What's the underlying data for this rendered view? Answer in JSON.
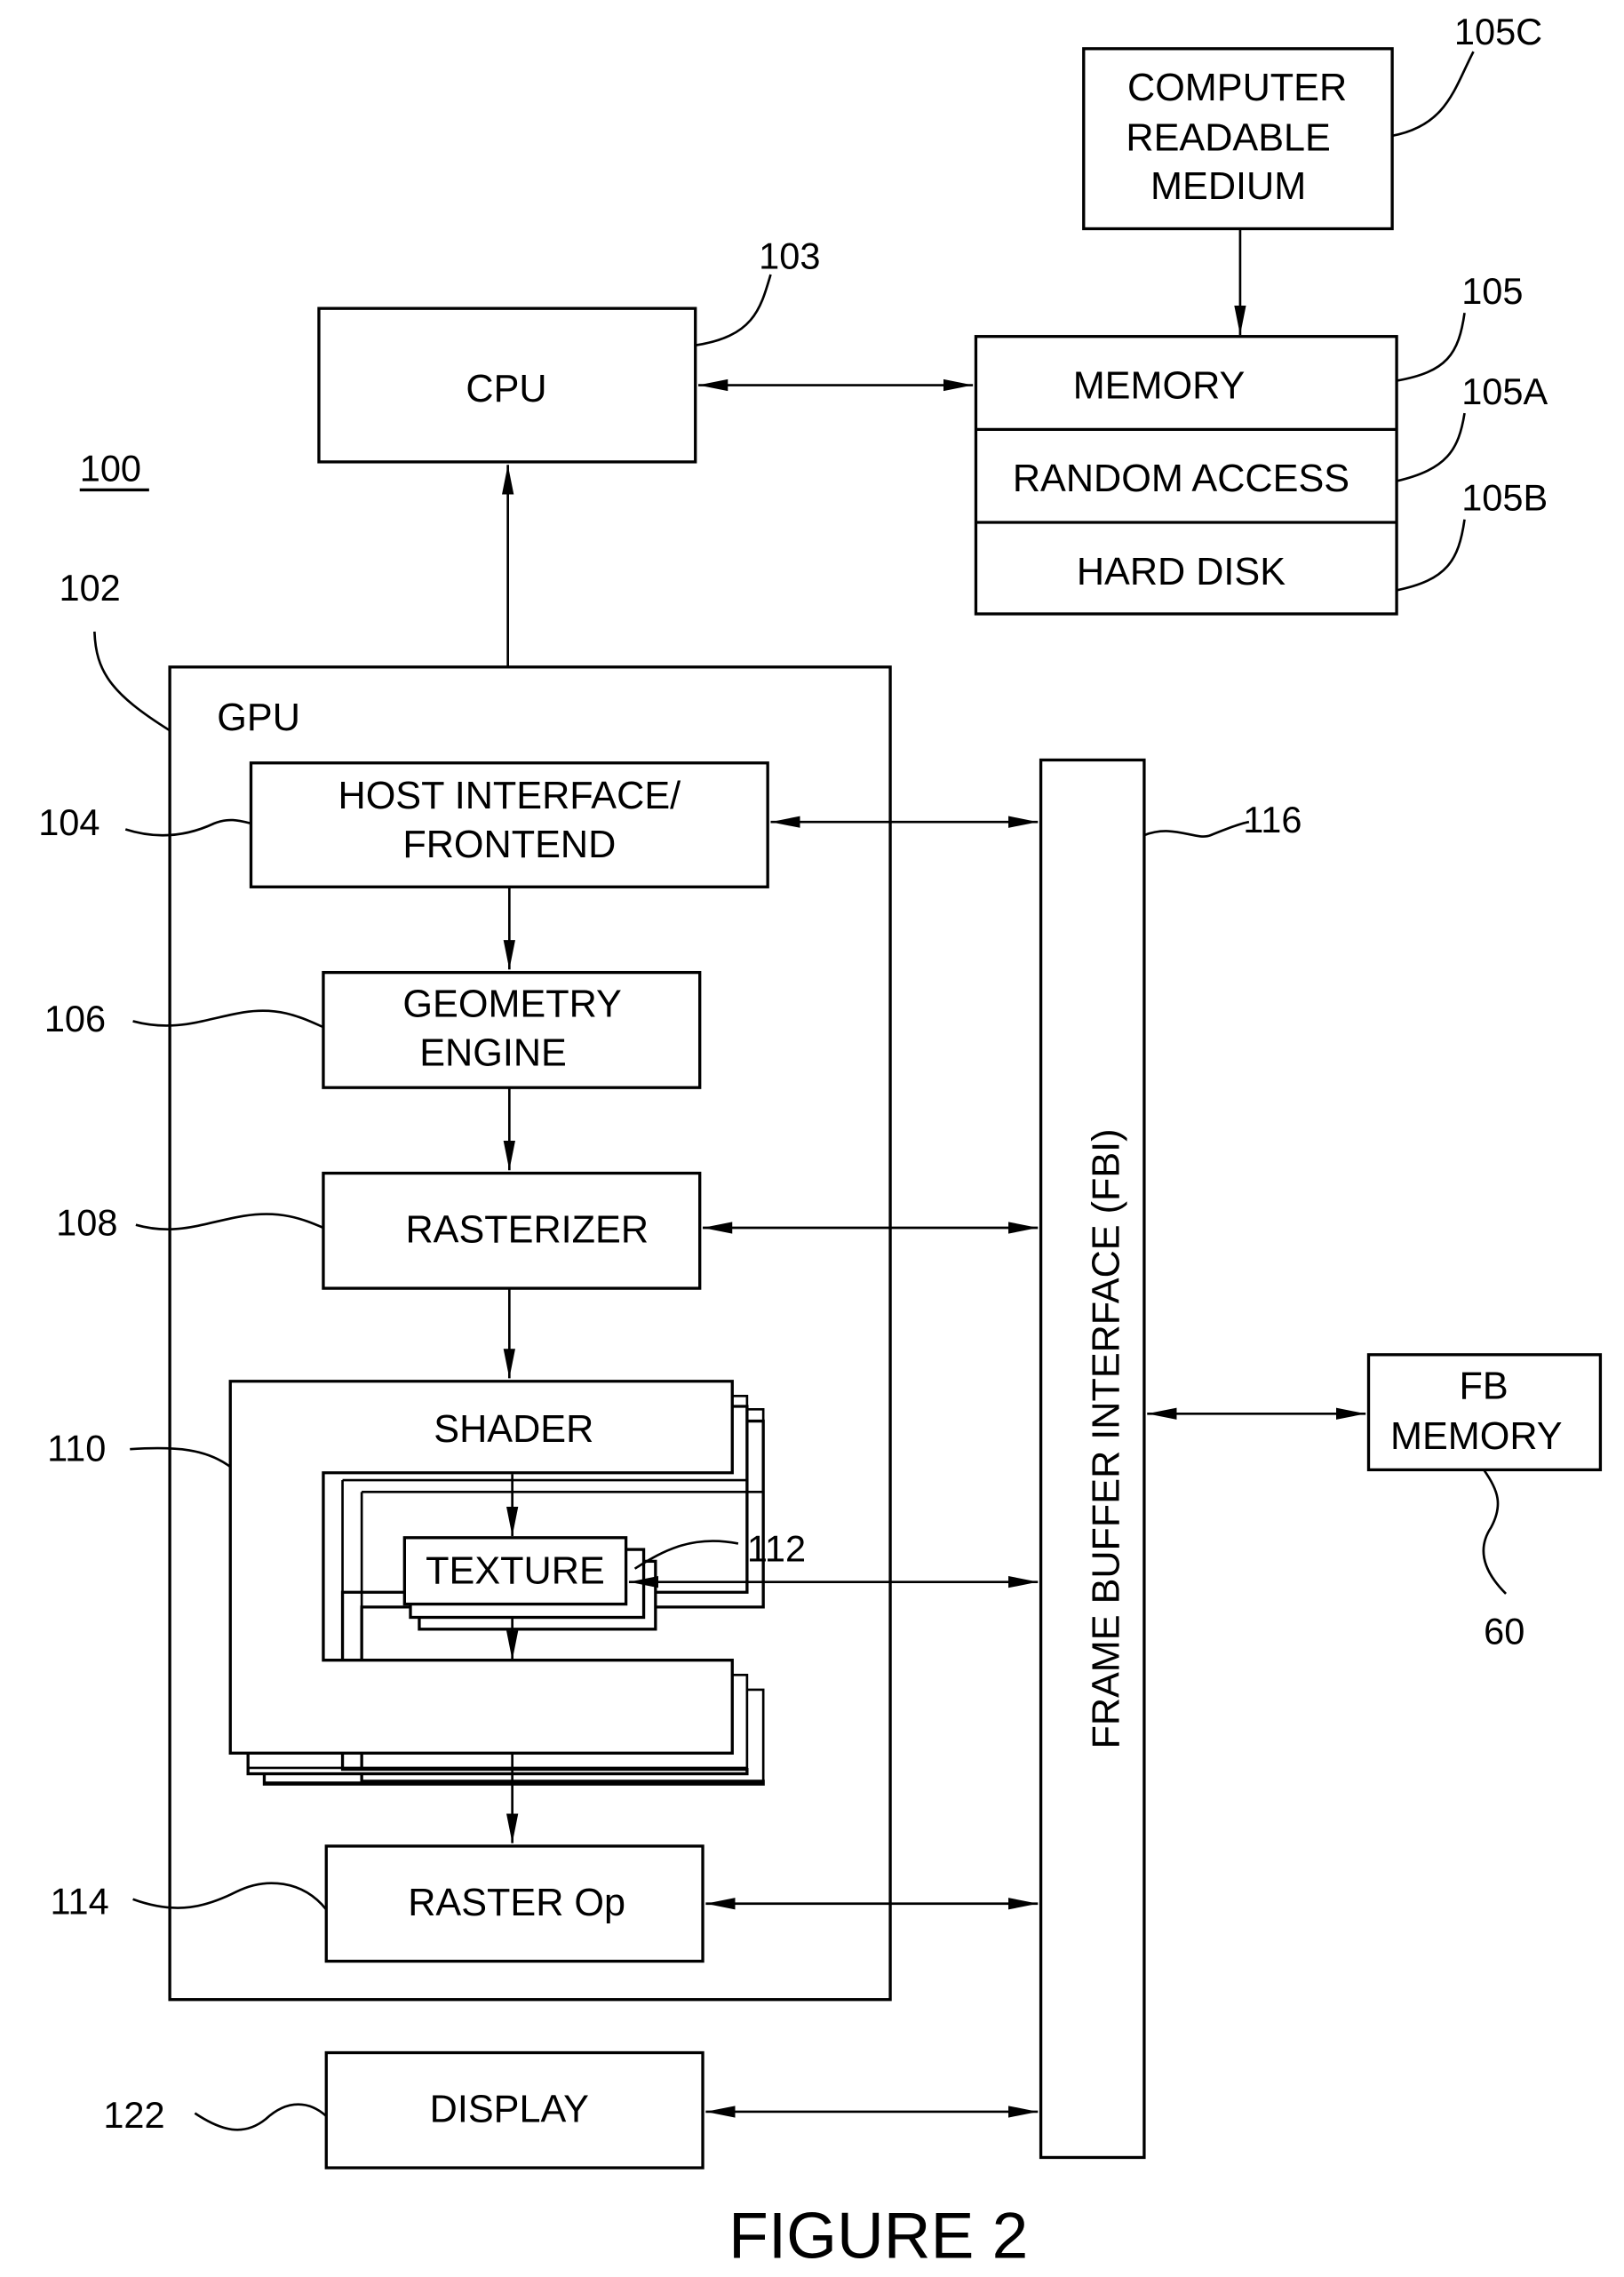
{
  "figure": {
    "caption": "FIGURE 2",
    "system_ref": "100"
  },
  "blocks": {
    "cpu": {
      "label": "CPU",
      "ref": "103"
    },
    "crm": {
      "lines": [
        "COMPUTER",
        "READABLE",
        "MEDIUM"
      ],
      "ref": "105C"
    },
    "memory": {
      "label": "MEMORY",
      "ref": "105"
    },
    "ram": {
      "label": "RANDOM ACCESS",
      "ref": "105A"
    },
    "hdd": {
      "label": "HARD DISK",
      "ref": "105B"
    },
    "gpu": {
      "label": "GPU",
      "ref": "102"
    },
    "host": {
      "lines": [
        "HOST INTERFACE/",
        "FRONTEND"
      ],
      "ref": "104"
    },
    "geometry": {
      "lines": [
        "GEOMETRY",
        "ENGINE"
      ],
      "ref": "106"
    },
    "rasterizer": {
      "label": "RASTERIZER",
      "ref": "108"
    },
    "shader": {
      "label": "SHADER",
      "ref": "110"
    },
    "texture": {
      "label": "TEXTURE",
      "ref": "112"
    },
    "rop": {
      "label": "RASTER Op",
      "ref": "114"
    },
    "display": {
      "label": "DISPLAY",
      "ref": "122"
    },
    "fbi": {
      "label": "FRAME BUFFER INTERFACE (FBI)",
      "ref": "116"
    },
    "fbmem": {
      "lines": [
        "FB",
        "MEMORY"
      ],
      "ref": "60"
    }
  }
}
